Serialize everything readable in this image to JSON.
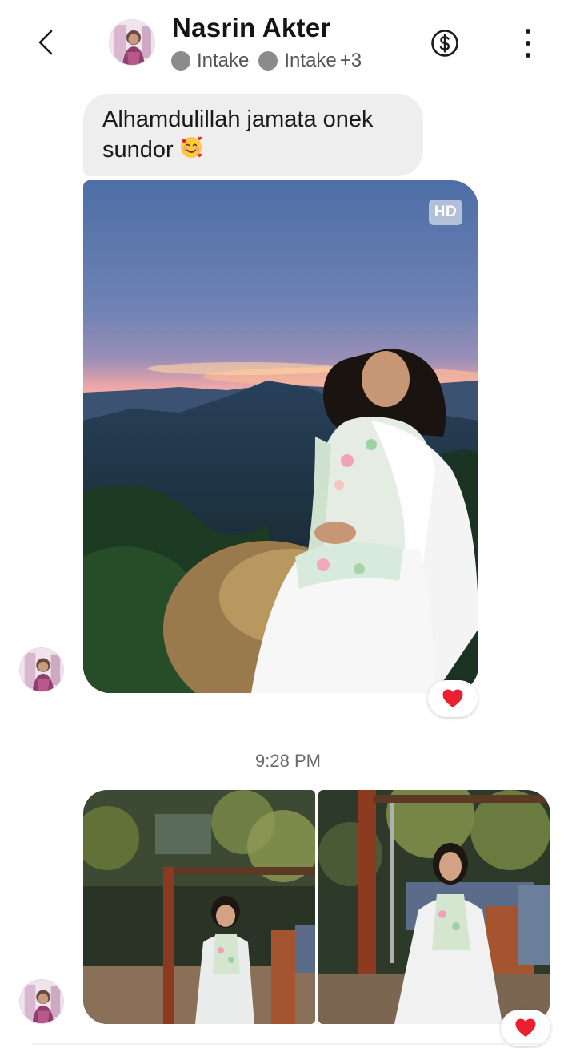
{
  "header": {
    "contact_name": "Nasrin Akter",
    "status_label_1": "Intake",
    "status_label_2": "Intake",
    "status_extra": "+3",
    "back_icon": "chevron-left-icon",
    "payment_icon": "dollar-circle-icon",
    "more_icon": "more-vertical-icon"
  },
  "messages": {
    "text_message": "Alhamdulillah jamata onek sundor",
    "text_emoji": "smiling-face-with-hearts",
    "photo_badge": "HD",
    "photo_reaction": "heart",
    "timestamp": "9:28 PM",
    "pair_reaction": "heart"
  },
  "colors": {
    "bubble_bg": "#eeeeee",
    "heart": "#e8202f",
    "status_dot": "#8b8b8b"
  }
}
